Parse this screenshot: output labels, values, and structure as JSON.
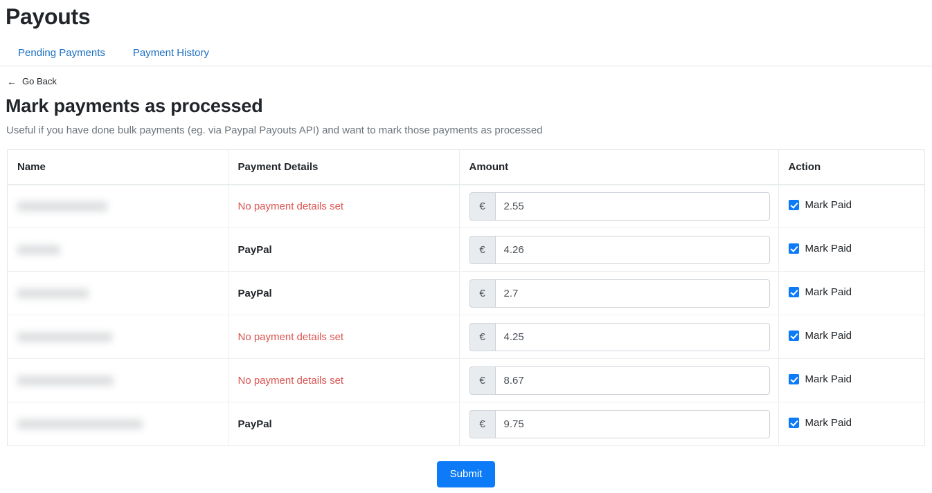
{
  "header": {
    "title": "Payouts",
    "tabs": [
      {
        "label": "Pending Payments",
        "name": "tab-pending-payments"
      },
      {
        "label": "Payment History",
        "name": "tab-payment-history"
      }
    ]
  },
  "back_link": {
    "arrow": "←",
    "label": "Go Back"
  },
  "section": {
    "title": "Mark payments as processed",
    "subtitle": "Useful if you have done bulk payments (eg. via Paypal Payouts API) and want to mark those payments as processed"
  },
  "table": {
    "columns": [
      "Name",
      "Payment Details",
      "Amount",
      "Action"
    ],
    "rows": [
      {
        "name": "",
        "name_redacted": true,
        "name_width": 130,
        "payment_details": "No payment details set",
        "payment_details_type": "none",
        "currency": "€",
        "amount": "2.55",
        "action_label": "Mark Paid",
        "action_checked": true
      },
      {
        "name": "",
        "name_redacted": true,
        "name_width": 62,
        "payment_details": "PayPal",
        "payment_details_type": "paypal",
        "currency": "€",
        "amount": "4.26",
        "action_label": "Mark Paid",
        "action_checked": true
      },
      {
        "name": "",
        "name_redacted": true,
        "name_width": 103,
        "payment_details": "PayPal",
        "payment_details_type": "paypal",
        "currency": "€",
        "amount": "2.7",
        "action_label": "Mark Paid",
        "action_checked": true
      },
      {
        "name": "",
        "name_redacted": true,
        "name_width": 137,
        "payment_details": "No payment details set",
        "payment_details_type": "none",
        "currency": "€",
        "amount": "4.25",
        "action_label": "Mark Paid",
        "action_checked": true
      },
      {
        "name": "",
        "name_redacted": true,
        "name_width": 139,
        "payment_details": "No payment details set",
        "payment_details_type": "none",
        "currency": "€",
        "amount": "8.67",
        "action_label": "Mark Paid",
        "action_checked": true
      },
      {
        "name": "",
        "name_redacted": true,
        "name_width": 181,
        "payment_details": "PayPal",
        "payment_details_type": "paypal",
        "currency": "€",
        "amount": "9.75",
        "action_label": "Mark Paid",
        "action_checked": true
      }
    ]
  },
  "footer": {
    "submit_label": "Submit"
  },
  "colors": {
    "accent": "#0d7bf7",
    "link": "#1b6ec2",
    "danger": "#d9534f",
    "muted": "#6c757d",
    "border": "#e3e6e8"
  }
}
